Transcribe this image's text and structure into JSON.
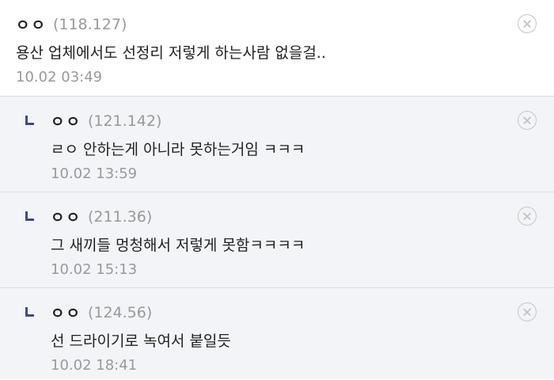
{
  "comments": [
    {
      "nickname": "ㅇㅇ",
      "ip": "(118.127)",
      "text": "용산 업체에서도 선정리 저렇게 하는사람 없을걸..",
      "date": "10.02 03:49"
    }
  ],
  "replies": [
    {
      "nickname": "ㅇㅇ",
      "ip": "(121.142)",
      "text": "ㄹㅇ 안하는게 아니라 못하는거임 ㅋㅋㅋ",
      "date": "10.02 13:59"
    },
    {
      "nickname": "ㅇㅇ",
      "ip": "(211.36)",
      "text": "그 새끼들 멍청해서 저렇게 못함ㅋㅋㅋㅋ",
      "date": "10.02 15:13"
    },
    {
      "nickname": "ㅇㅇ",
      "ip": "(124.56)",
      "text": "선 드라이기로 녹여서 붙일듯",
      "date": "10.02 18:41"
    }
  ],
  "icons": {
    "delete": "close-circle-icon",
    "reply": "reply-arrow-icon"
  },
  "colors": {
    "reply_background": "#f3f4f7",
    "reply_mark": "#3f4a8f",
    "meta_text": "#999999"
  }
}
